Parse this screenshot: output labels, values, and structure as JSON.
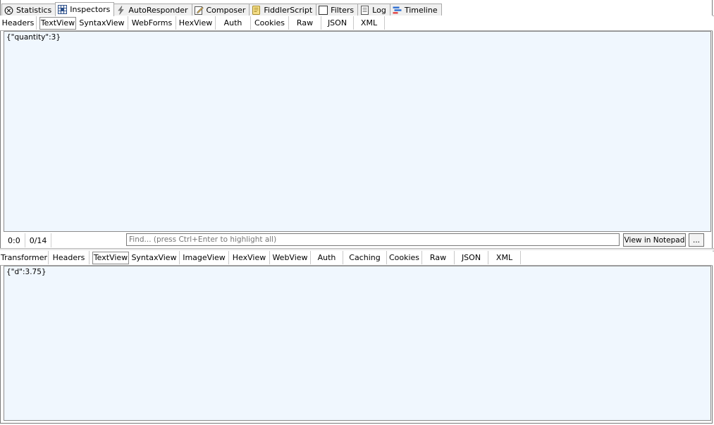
{
  "main_tabs": [
    {
      "label": "Statistics",
      "icon": "stopwatch-icon",
      "active": false
    },
    {
      "label": "Inspectors",
      "icon": "inspector-grid-icon",
      "active": true
    },
    {
      "label": "AutoResponder",
      "icon": "lightning-icon",
      "active": false
    },
    {
      "label": "Composer",
      "icon": "pencil-note-icon",
      "active": false
    },
    {
      "label": "FiddlerScript",
      "icon": "script-icon",
      "active": false
    },
    {
      "label": "Filters",
      "icon": "checkbox-icon",
      "active": false
    },
    {
      "label": "Log",
      "icon": "log-icon",
      "active": false
    },
    {
      "label": "Timeline",
      "icon": "timeline-icon",
      "active": false
    }
  ],
  "request": {
    "tabs": [
      "Headers",
      "TextView",
      "SyntaxView",
      "WebForms",
      "HexView",
      "Auth",
      "Cookies",
      "Raw",
      "JSON",
      "XML"
    ],
    "active_tab": "TextView",
    "body": "{\"quantity\":3}",
    "status": {
      "position": "0:0",
      "count": "0/14"
    },
    "find_placeholder": "Find... (press Ctrl+Enter to highlight all)",
    "view_in_notepad_label": "View in Notepad",
    "more_label": "..."
  },
  "response": {
    "tabs": [
      "Transformer",
      "Headers",
      "TextView",
      "SyntaxView",
      "ImageView",
      "HexView",
      "WebView",
      "Auth",
      "Caching",
      "Cookies",
      "Raw",
      "JSON",
      "XML"
    ],
    "active_tab": "TextView",
    "body": "{\"d\":3.75}"
  },
  "colors": {
    "pane_background": "#f0f7fe",
    "tab_background": "#f0f0f0",
    "border": "#8c8c8c"
  }
}
